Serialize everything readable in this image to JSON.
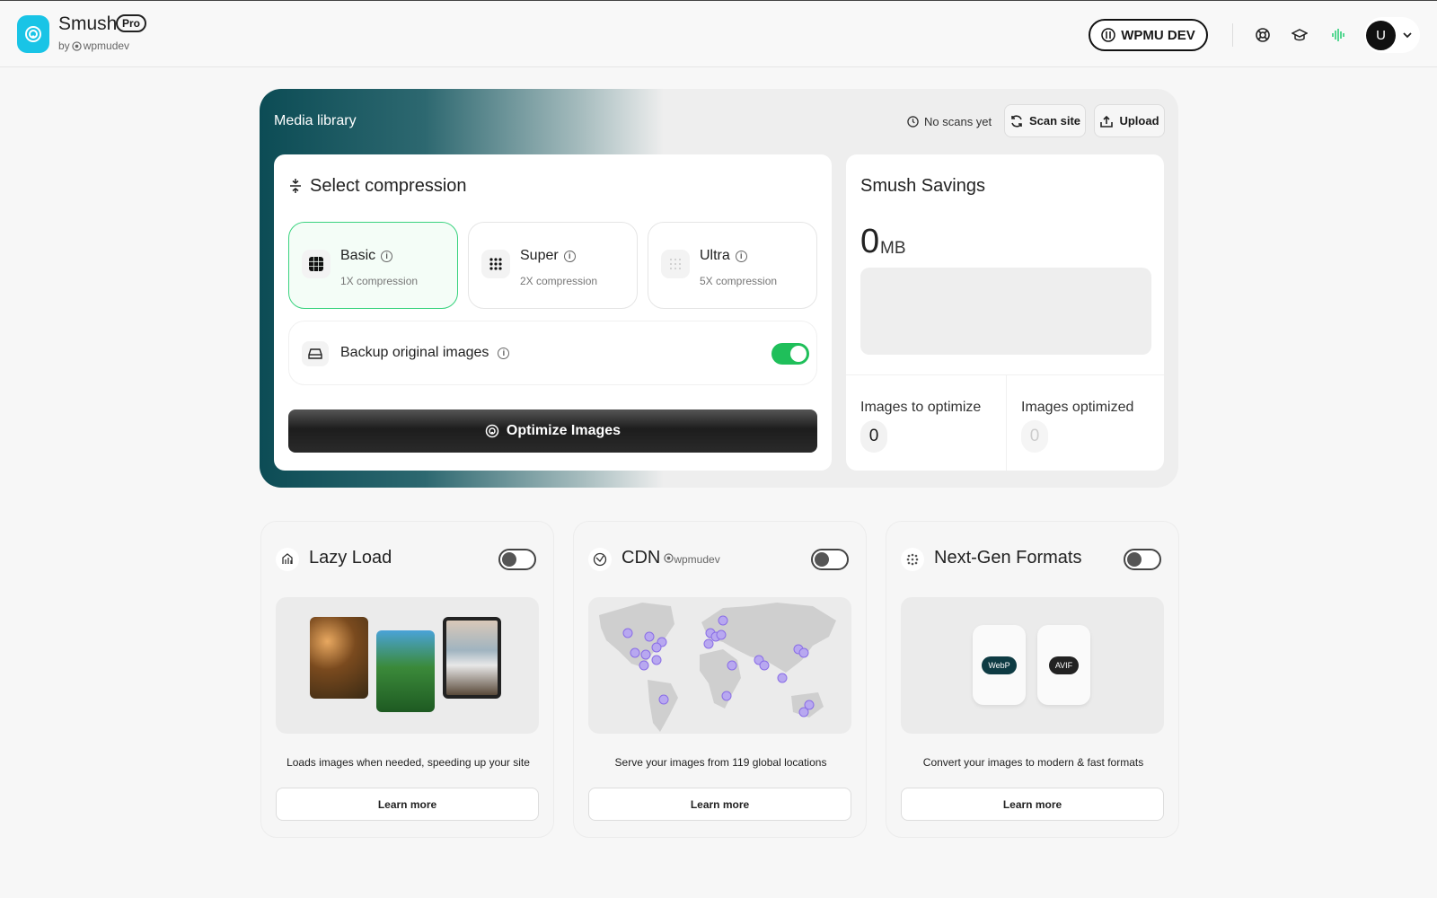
{
  "app": {
    "name": "Smush",
    "badge": "Pro",
    "by": "by",
    "by_brand": "wpmudev"
  },
  "header": {
    "wpmu_button": "WPMU DEV",
    "avatar_letter": "U"
  },
  "media": {
    "title": "Media library",
    "scan_status": "No scans yet",
    "scan_button": "Scan site",
    "upload_button": "Upload"
  },
  "compression": {
    "title": "Select compression",
    "options": [
      {
        "label": "Basic",
        "sub": "1X compression"
      },
      {
        "label": "Super",
        "sub": "2X compression"
      },
      {
        "label": "Ultra",
        "sub": "5X compression"
      }
    ],
    "backup_label": "Backup original images",
    "optimize_button": "Optimize Images"
  },
  "savings": {
    "title": "Smush Savings",
    "value": "0",
    "unit": "MB",
    "to_optimize_label": "Images to optimize",
    "to_optimize_value": "0",
    "optimized_label": "Images optimized",
    "optimized_value": "0"
  },
  "features": [
    {
      "title": "Lazy Load",
      "desc": "Loads images when needed, speeding up your site",
      "button": "Learn more"
    },
    {
      "title": "CDN",
      "brand": "wpmudev",
      "desc": "Serve your images from 119 global locations",
      "button": "Learn more"
    },
    {
      "title": "Next-Gen Formats",
      "desc": "Convert your images to modern & fast formats",
      "button": "Learn more",
      "formats": [
        "WebP",
        "AVIF"
      ]
    }
  ],
  "colors": {
    "accent": "#19c4e6",
    "toggle_on": "#1fbf5a",
    "panel_dark": "#0c4c55"
  }
}
